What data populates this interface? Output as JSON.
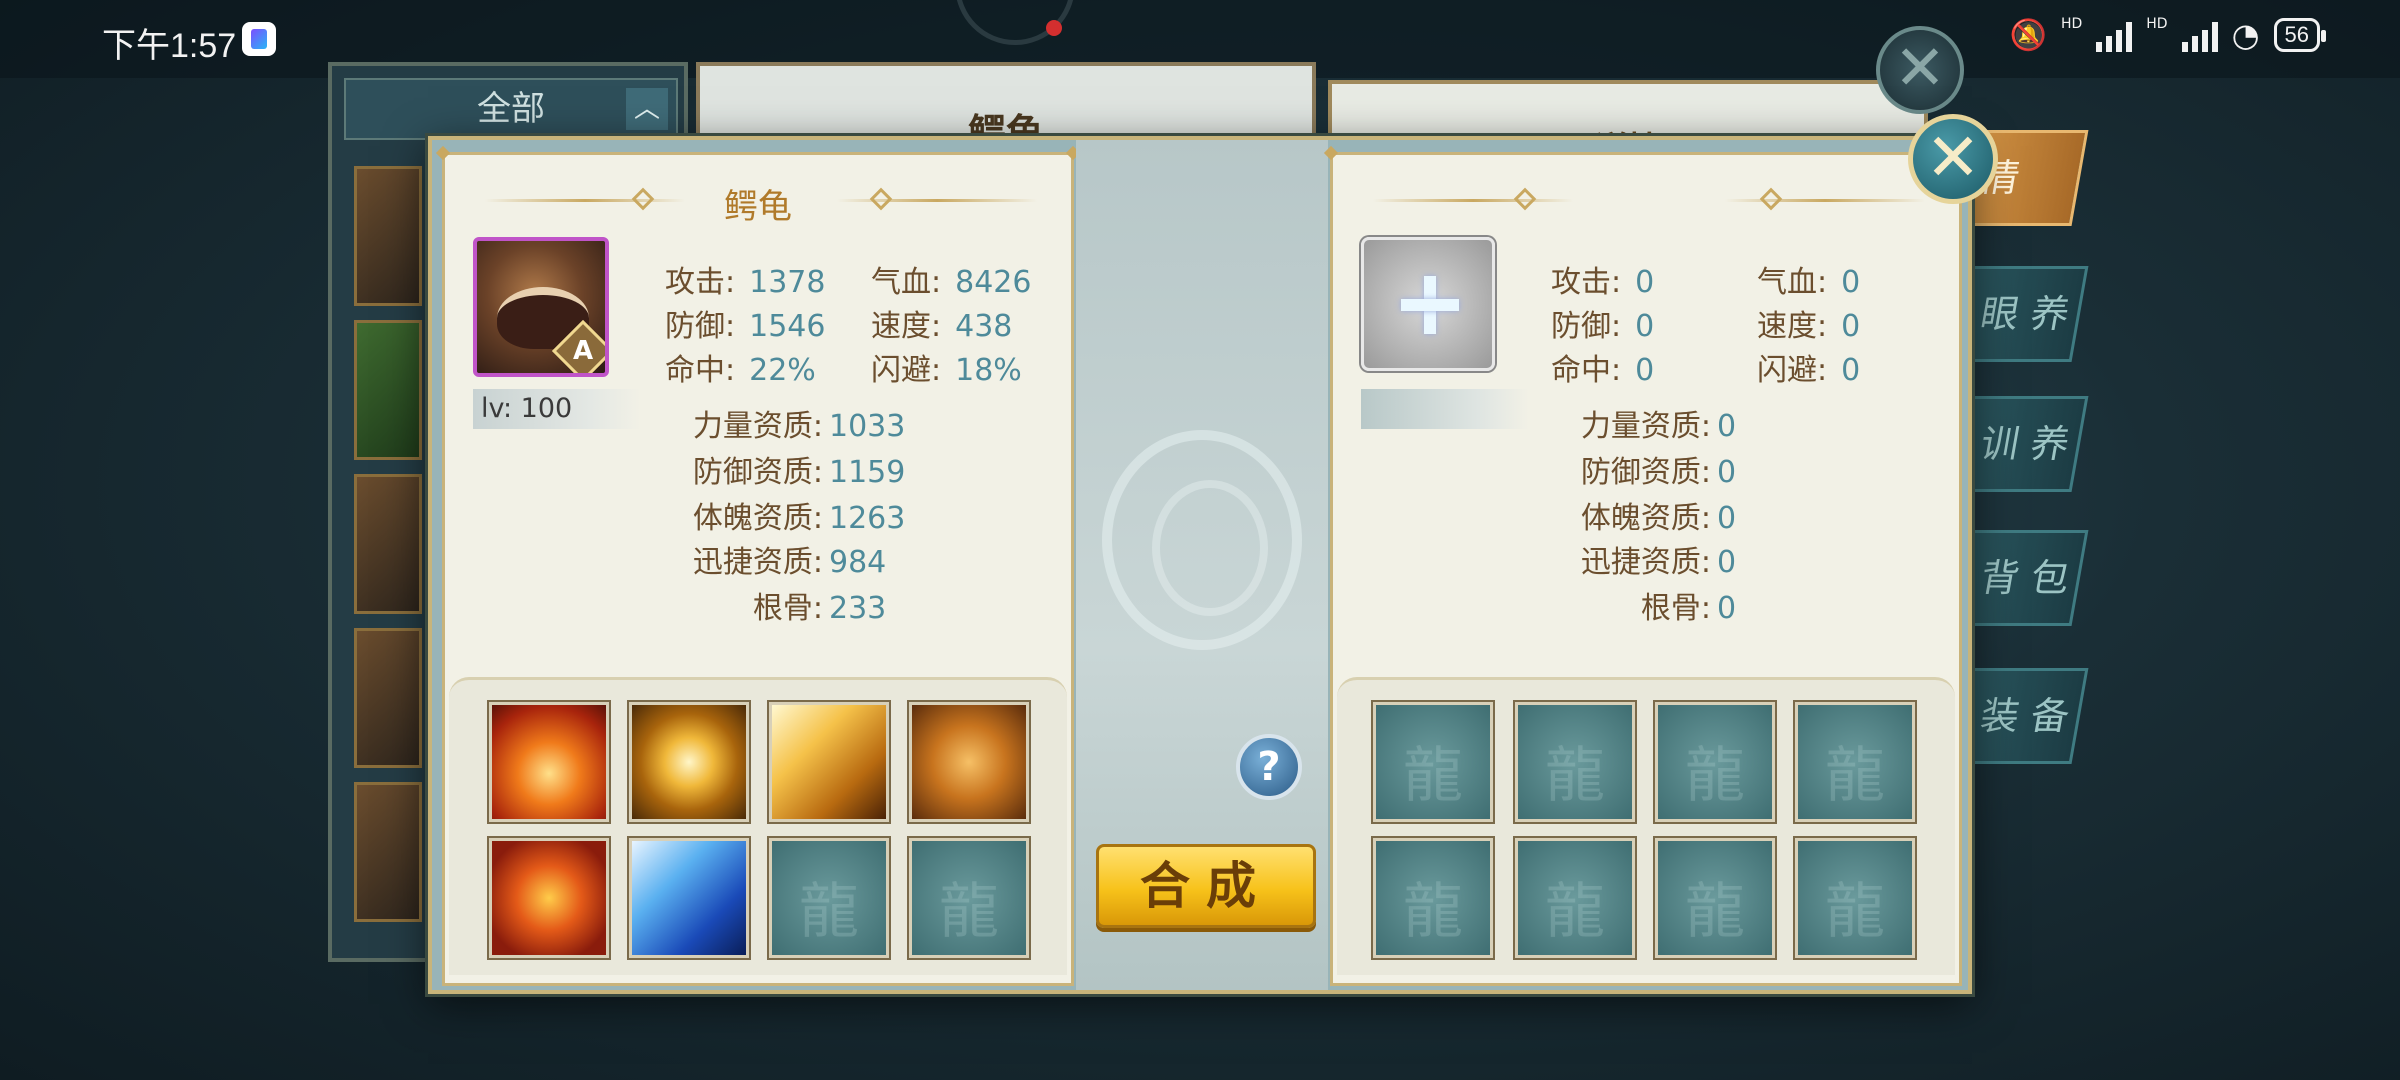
{
  "status_bar": {
    "time": "下午1:57",
    "network_1": "HD",
    "network_2": "HD",
    "battery": "56"
  },
  "background": {
    "filter_tab": "全部",
    "center_title": "鳄龟",
    "right_title": "详情",
    "side_tabs": [
      "情",
      "眼 养",
      "训 养",
      "背 包",
      "装 备"
    ]
  },
  "left_pet": {
    "name": "鳄龟",
    "grade": "A",
    "level": "lv: 100",
    "stats": [
      {
        "label": "攻击:",
        "value": "1378"
      },
      {
        "label": "气血:",
        "value": "8426"
      },
      {
        "label": "防御:",
        "value": "1546"
      },
      {
        "label": "速度:",
        "value": "438"
      },
      {
        "label": "命中:",
        "value": "22%"
      },
      {
        "label": "闪避:",
        "value": "18%"
      }
    ],
    "aptitudes": [
      {
        "label": "力量资质:",
        "value": "1033"
      },
      {
        "label": "防御资质:",
        "value": "1159"
      },
      {
        "label": "体魄资质:",
        "value": "1263"
      },
      {
        "label": "迅捷资质:",
        "value": "984"
      },
      {
        "label": "根骨:",
        "value": "233"
      }
    ],
    "skills": [
      "fire-burst-skill",
      "golden-sun-skill",
      "light-beam-skill",
      "roaring-lion-skill",
      "flame-orb-skill",
      "blue-strike-skill",
      "empty",
      "empty"
    ]
  },
  "right_pet": {
    "stats": [
      {
        "label": "攻击:",
        "value": "0"
      },
      {
        "label": "气血:",
        "value": "0"
      },
      {
        "label": "防御:",
        "value": "0"
      },
      {
        "label": "速度:",
        "value": "0"
      },
      {
        "label": "命中:",
        "value": "0"
      },
      {
        "label": "闪避:",
        "value": "0"
      }
    ],
    "aptitudes": [
      {
        "label": "力量资质:",
        "value": "0"
      },
      {
        "label": "防御资质:",
        "value": "0"
      },
      {
        "label": "体魄资质:",
        "value": "0"
      },
      {
        "label": "迅捷资质:",
        "value": "0"
      },
      {
        "label": "根骨:",
        "value": "0"
      }
    ]
  },
  "actions": {
    "synthesize": "合成",
    "help": "?",
    "close": "✕"
  },
  "colors": {
    "label": "#6b4e2e",
    "value": "#4e8a9a",
    "title": "#b07a2a",
    "button_gold": "#f7c21a"
  }
}
